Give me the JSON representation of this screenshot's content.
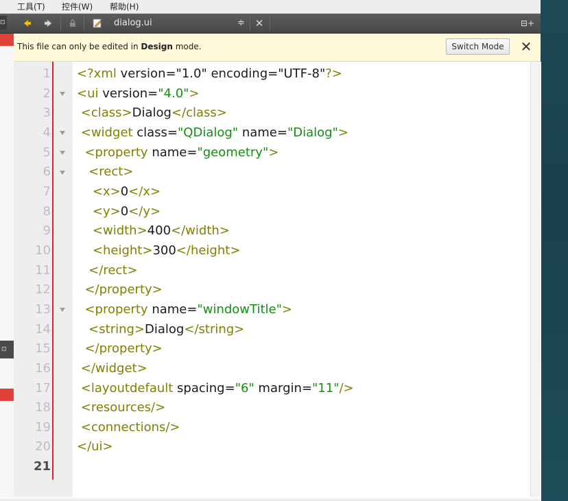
{
  "menubar": {
    "items": [
      {
        "label": "·"
      },
      {
        "label": "工具(T)"
      },
      {
        "label": "控件(W)"
      },
      {
        "label": "帮助(H)"
      }
    ]
  },
  "toolbar": {
    "file_name": "dialog.ui",
    "dropdown_arrow": "≑",
    "close_glyph": "✕",
    "split_glyph": "⊟+"
  },
  "notice": {
    "text_prefix": "This file can only be edited in ",
    "text_bold": "Design",
    "text_suffix": " mode.",
    "switch_label": "Switch Mode",
    "close_glyph": "✕"
  },
  "editor": {
    "current_line": 21,
    "fold_lines": [
      2,
      4,
      5,
      6,
      13
    ],
    "lines": [
      {
        "n": "1",
        "segs": [
          [
            "tag",
            "<?xml"
          ],
          [
            "txt",
            " version=\"1.0\" encoding=\"UTF-8\""
          ],
          [
            "tag",
            "?>"
          ]
        ]
      },
      {
        "n": "2",
        "segs": [
          [
            "tag",
            "<ui"
          ],
          [
            "txt",
            " version="
          ],
          [
            "str",
            "\"4.0\""
          ],
          [
            "tag",
            ">"
          ]
        ]
      },
      {
        "n": "3",
        "segs": [
          [
            "txt",
            " "
          ],
          [
            "tag",
            "<class>"
          ],
          [
            "txt",
            "Dialog"
          ],
          [
            "tag",
            "</class>"
          ]
        ]
      },
      {
        "n": "4",
        "segs": [
          [
            "txt",
            " "
          ],
          [
            "tag",
            "<widget"
          ],
          [
            "txt",
            " class="
          ],
          [
            "str",
            "\"QDialog\""
          ],
          [
            "txt",
            " name="
          ],
          [
            "str",
            "\"Dialog\""
          ],
          [
            "tag",
            ">"
          ]
        ]
      },
      {
        "n": "5",
        "segs": [
          [
            "txt",
            "  "
          ],
          [
            "tag",
            "<property"
          ],
          [
            "txt",
            " name="
          ],
          [
            "str",
            "\"geometry\""
          ],
          [
            "tag",
            ">"
          ]
        ]
      },
      {
        "n": "6",
        "segs": [
          [
            "txt",
            "   "
          ],
          [
            "tag",
            "<rect>"
          ]
        ]
      },
      {
        "n": "7",
        "segs": [
          [
            "txt",
            "    "
          ],
          [
            "tag",
            "<x>"
          ],
          [
            "txt",
            "0"
          ],
          [
            "tag",
            "</x>"
          ]
        ]
      },
      {
        "n": "8",
        "segs": [
          [
            "txt",
            "    "
          ],
          [
            "tag",
            "<y>"
          ],
          [
            "txt",
            "0"
          ],
          [
            "tag",
            "</y>"
          ]
        ]
      },
      {
        "n": "9",
        "segs": [
          [
            "txt",
            "    "
          ],
          [
            "tag",
            "<width>"
          ],
          [
            "txt",
            "400"
          ],
          [
            "tag",
            "</width>"
          ]
        ]
      },
      {
        "n": "10",
        "segs": [
          [
            "txt",
            "    "
          ],
          [
            "tag",
            "<height>"
          ],
          [
            "txt",
            "300"
          ],
          [
            "tag",
            "</height>"
          ]
        ]
      },
      {
        "n": "11",
        "segs": [
          [
            "txt",
            "   "
          ],
          [
            "tag",
            "</rect>"
          ]
        ]
      },
      {
        "n": "12",
        "segs": [
          [
            "txt",
            "  "
          ],
          [
            "tag",
            "</property>"
          ]
        ]
      },
      {
        "n": "13",
        "segs": [
          [
            "txt",
            "  "
          ],
          [
            "tag",
            "<property"
          ],
          [
            "txt",
            " name="
          ],
          [
            "str",
            "\"windowTitle\""
          ],
          [
            "tag",
            ">"
          ]
        ]
      },
      {
        "n": "14",
        "segs": [
          [
            "txt",
            "   "
          ],
          [
            "tag",
            "<string>"
          ],
          [
            "txt",
            "Dialog"
          ],
          [
            "tag",
            "</string>"
          ]
        ]
      },
      {
        "n": "15",
        "segs": [
          [
            "txt",
            "  "
          ],
          [
            "tag",
            "</property>"
          ]
        ]
      },
      {
        "n": "16",
        "segs": [
          [
            "txt",
            " "
          ],
          [
            "tag",
            "</widget>"
          ]
        ]
      },
      {
        "n": "17",
        "segs": [
          [
            "txt",
            " "
          ],
          [
            "tag",
            "<layoutdefault"
          ],
          [
            "txt",
            " spacing="
          ],
          [
            "str",
            "\"6\""
          ],
          [
            "txt",
            " margin="
          ],
          [
            "str",
            "\"11\""
          ],
          [
            "tag",
            "/>"
          ]
        ]
      },
      {
        "n": "18",
        "segs": [
          [
            "txt",
            " "
          ],
          [
            "tag",
            "<resources/>"
          ]
        ]
      },
      {
        "n": "19",
        "segs": [
          [
            "txt",
            " "
          ],
          [
            "tag",
            "<connections/>"
          ]
        ]
      },
      {
        "n": "20",
        "segs": [
          [
            "tag",
            "</ui>"
          ]
        ]
      },
      {
        "n": "21",
        "segs": []
      }
    ]
  },
  "colors": {
    "tag": "#808000",
    "string": "#118f11",
    "text": "#1a1a1a",
    "gutter_line": "#d9232b",
    "notice_bg": "#fcf8d8",
    "toolbar_bg": "#505050",
    "back_arrow": "#f2c10f"
  },
  "icons": {
    "back": "arrow-left-icon",
    "forward": "arrow-right-icon",
    "lock": "lock-icon",
    "edit": "edit-document-icon",
    "fold": "fold-triangle-icon"
  }
}
